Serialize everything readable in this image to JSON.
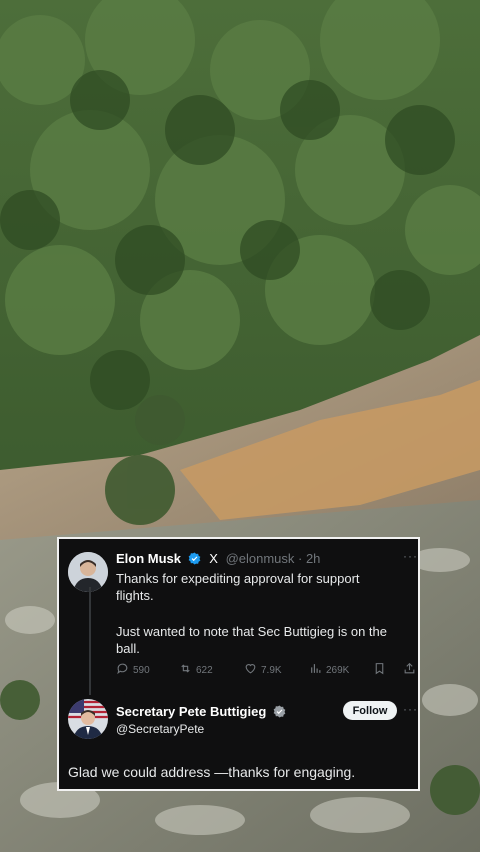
{
  "tweet": {
    "author_name": "Elon Musk",
    "platform_mark": "X",
    "handle_time": "@elonmusk · 2h",
    "text_line1": "Thanks for expediting approval for support",
    "text_line2": "flights.",
    "text_line3": "Just wanted to note that Sec Buttigieg is on the",
    "text_line4": "ball.",
    "stats": {
      "replies": "590",
      "reposts": "622",
      "likes": "7.9K",
      "views": "269K"
    }
  },
  "reply": {
    "author_name": "Secretary Pete Buttigieg",
    "handle": "@SecretaryPete",
    "follow_label": "Follow",
    "text": "Glad we could address —thanks for engaging."
  },
  "colors": {
    "verified": "#1d9bf0",
    "card_bg": "#0f0f10",
    "muted": "#71767b"
  }
}
